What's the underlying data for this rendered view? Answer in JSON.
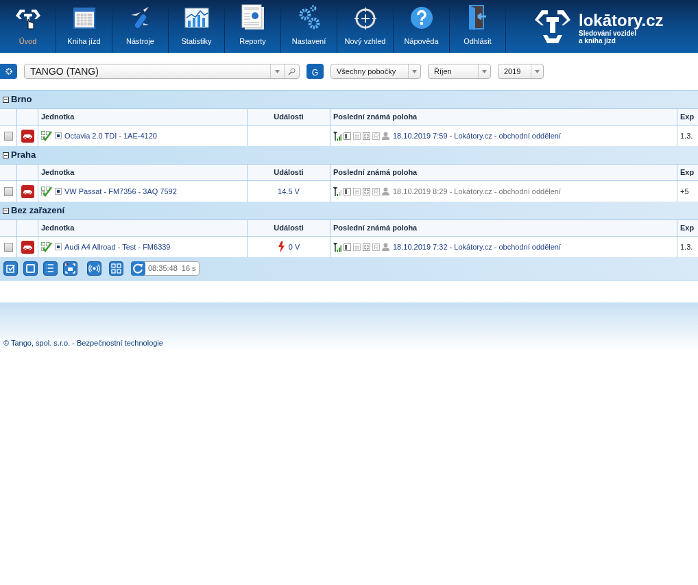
{
  "nav": [
    {
      "label": "Úvod",
      "selected": true
    },
    {
      "label": "Kniha jízd",
      "selected": false
    },
    {
      "label": "Nástroje",
      "selected": false
    },
    {
      "label": "Statistiky",
      "selected": false
    },
    {
      "label": "Reporty",
      "selected": false
    },
    {
      "label": "Nastavení",
      "selected": false
    },
    {
      "label": "Nový vzhled",
      "selected": false
    },
    {
      "label": "Nápověda",
      "selected": false
    },
    {
      "label": "Odhlásit",
      "selected": false
    }
  ],
  "brand": {
    "name": "lokātory.cz",
    "tagline_1": "Sledování vozidel",
    "tagline_2": "a kniha jízd"
  },
  "toolbar": {
    "company": "TANGO (TANG)",
    "g_button": "G",
    "branch": "Všechny pobočky",
    "month": "Říjen",
    "year": "2019"
  },
  "groups": [
    {
      "name": "Brno",
      "expanded": true,
      "columns": [
        "Jednotka",
        "Události",
        "Poslední známá poloha",
        "Exp"
      ],
      "rows": [
        {
          "checked": false,
          "unit": "Octavia 2.0 TDI - 1AE-4120",
          "event": "",
          "alert": false,
          "stale": false,
          "position": "18.10.2019 7:59 - Lokátory.cz - obchodní oddělení",
          "column_5": "1.3."
        }
      ]
    },
    {
      "name": "Praha",
      "expanded": true,
      "columns": [
        "Jednotka",
        "Události",
        "Poslední známá poloha",
        "Exp"
      ],
      "rows": [
        {
          "checked": false,
          "unit": "VW Passat - FM7356 - 3AQ 7592",
          "event": "14.5 V",
          "alert": false,
          "stale": true,
          "position": "18.10.2019 8:29 - Lokátory.cz - obchodní oddělení",
          "column_5": "+5"
        }
      ]
    },
    {
      "name": "Bez zařazení",
      "expanded": true,
      "columns": [
        "Jednotka",
        "Události",
        "Poslední známá poloha",
        "Exp"
      ],
      "rows": [
        {
          "checked": false,
          "unit": "Audi A4 Allroad - Test - FM6339",
          "event": "0 V",
          "alert": true,
          "stale": false,
          "position": "18.10.2019 7:32 - Lokátory.cz - obchodní oddělení",
          "column_5": "1.3."
        }
      ]
    }
  ],
  "refresh": {
    "time": "08:35:48",
    "interval": "16 s"
  },
  "footer": "© Tango, spol. s.r.o. - Bezpečnostní technologie"
}
